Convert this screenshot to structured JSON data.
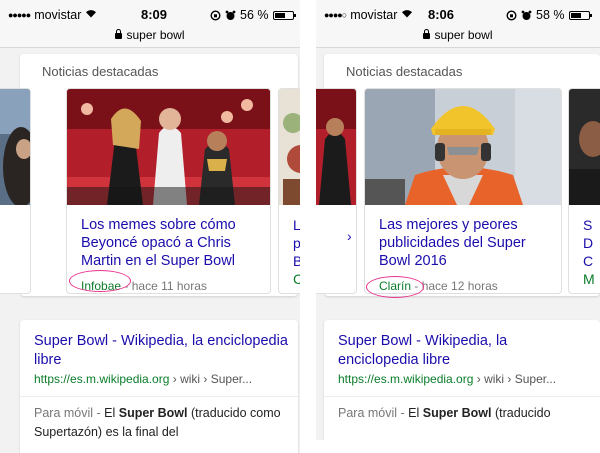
{
  "screens": [
    {
      "status": {
        "carrier": "movistar",
        "time": "8:09",
        "battery": "56 %",
        "battery_level": 0.56
      },
      "url": "super bowl",
      "news_header": "Noticias destacadas",
      "card": {
        "headline": "Los memes sobre cómo Beyoncé opacó a Chris Martin en el Super Bowl",
        "source": "Infobae",
        "time": "hace 11 horas"
      },
      "peek": {
        "line1": "La",
        "line2": "pu",
        "line3": "Be",
        "line4": "Cl"
      },
      "result": {
        "title": "Super Bowl - Wikipedia, la enciclopedia libre",
        "url_domain": "https://es.m.wikipedia.org",
        "url_path": " › wiki › Super...",
        "snippet_prefix": "Para móvil - ",
        "snippet_rest_pre": "El ",
        "snippet_bold": "Super Bowl",
        "snippet_rest": " (traducido como Supertazón) es la final del"
      }
    },
    {
      "status": {
        "carrier": "movistar",
        "time": "8:06",
        "battery": "58 %",
        "battery_level": 0.58
      },
      "url": "super bowl",
      "news_header": "Noticias destacadas",
      "card": {
        "headline": "Las mejores y peores publicidades del Super Bowl 2016",
        "source": "Clarín",
        "time": "hace 12 horas"
      },
      "peek": {
        "line1": "S",
        "line2": "D",
        "line3": "C",
        "line4": "M"
      },
      "result": {
        "title": "Super Bowl - Wikipedia, la enciclopedia libre",
        "url_domain": "https://es.m.wikipedia.org",
        "url_path": " › wiki › Super...",
        "snippet_prefix": "Para móvil - ",
        "snippet_rest_pre": "El ",
        "snippet_bold": "Super Bowl",
        "snippet_rest": " (traducido"
      }
    }
  ],
  "icons": [
    "signal-dots-icon",
    "wifi-icon",
    "lock-icon",
    "alarm-icon",
    "battery-icon"
  ],
  "colors": {
    "link": "#1a0dab",
    "url_green": "#0a7c2a",
    "highlight_circle": "#e8348c"
  }
}
